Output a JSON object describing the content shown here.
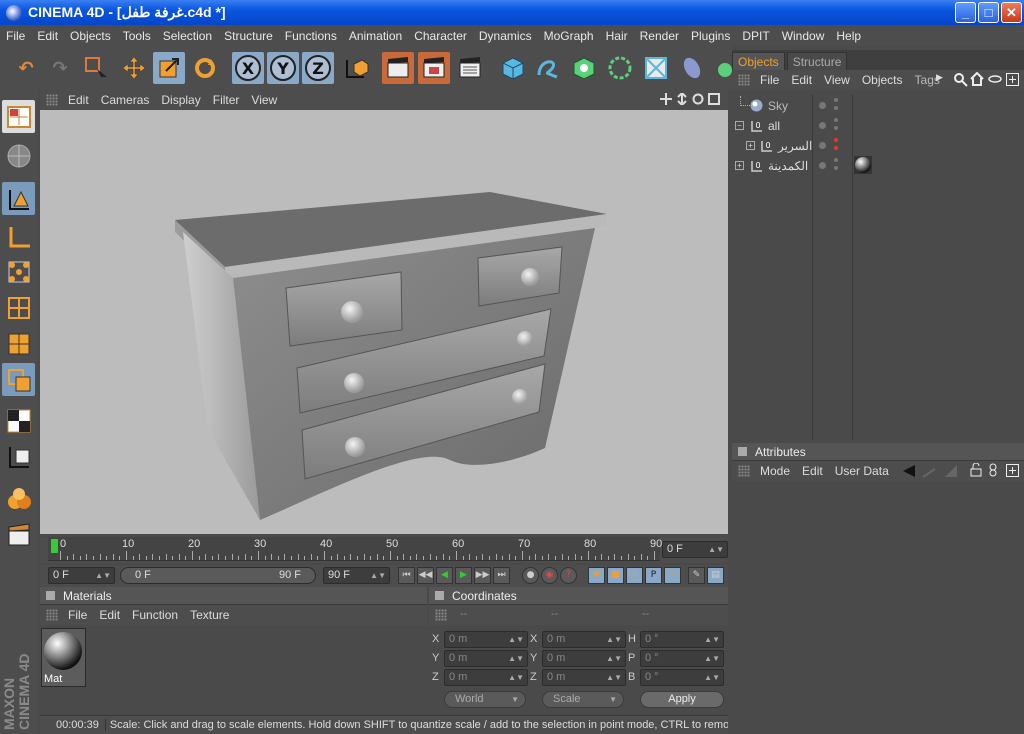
{
  "window": {
    "title": "CINEMA 4D - [غرفة طفل.c4d *]",
    "minimize": "_",
    "maximize": "□",
    "close": "✕"
  },
  "menubar": [
    "File",
    "Edit",
    "Objects",
    "Tools",
    "Selection",
    "Structure",
    "Functions",
    "Animation",
    "Character",
    "Dynamics",
    "MoGraph",
    "Hair",
    "Render",
    "Plugins",
    "DPIT",
    "Window",
    "Help"
  ],
  "toolbar": {
    "axes": [
      "X",
      "Y",
      "Z"
    ],
    "tools": [
      "undo-icon",
      "redo-icon",
      "live-selection-icon",
      "move-icon",
      "scale-icon",
      "rotate-icon",
      "x-axis-icon",
      "y-axis-icon",
      "z-axis-icon",
      "world-coordinates-icon",
      "render-view-icon",
      "render-picture-viewer-icon",
      "render-settings-icon",
      "cube-icon",
      "spline-icon",
      "nurbs-icon",
      "array-icon",
      "deformer-icon",
      "scene-icon",
      "light-icon"
    ]
  },
  "viewport": {
    "menu": [
      "Edit",
      "Cameras",
      "Display",
      "Filter",
      "View"
    ]
  },
  "timeline": {
    "ticks": [
      "0",
      "10",
      "20",
      "30",
      "40",
      "50",
      "60",
      "70",
      "80",
      "90"
    ],
    "current_frame": "0 F",
    "start_frame": "0 F",
    "range_start": "0 F",
    "range_end": "90 F",
    "end_frame": "90 F"
  },
  "materials": {
    "title": "Materials",
    "menu": [
      "File",
      "Edit",
      "Function",
      "Texture"
    ],
    "items": [
      {
        "name": "Mat"
      }
    ]
  },
  "coordinates": {
    "title": "Coordinates",
    "header": [
      "--",
      "--",
      "--"
    ],
    "rows": [
      {
        "l1": "X",
        "v1": "0 m",
        "l2": "X",
        "v2": "0 m",
        "l3": "H",
        "v3": "0 °"
      },
      {
        "l1": "Y",
        "v1": "0 m",
        "l2": "Y",
        "v2": "0 m",
        "l3": "P",
        "v3": "0 °"
      },
      {
        "l1": "Z",
        "v1": "0 m",
        "l2": "Z",
        "v2": "0 m",
        "l3": "B",
        "v3": "0 °"
      }
    ],
    "mode": "World",
    "transform": "Scale",
    "apply": "Apply"
  },
  "status": {
    "time": "00:00:39",
    "message": "Scale: Click and drag to scale elements. Hold down SHIFT to quantize scale / add to the selection in point mode, CTRL to remove."
  },
  "objects_panel": {
    "tabs": [
      "Objects",
      "Structure"
    ],
    "menu": [
      "File",
      "Edit",
      "View",
      "Objects",
      "Tags"
    ],
    "items": [
      {
        "name": "Sky",
        "type": "sky"
      },
      {
        "name": "all",
        "type": "null"
      },
      {
        "name": "السرير",
        "type": "null"
      },
      {
        "name": "الكمدينة",
        "type": "null"
      }
    ]
  },
  "attributes_panel": {
    "title": "Attributes",
    "menu": [
      "Mode",
      "Edit",
      "User Data"
    ]
  },
  "colors": {
    "accent": "#f0a030",
    "selected_tool": "#8aa8c8",
    "viewport_bg": "#bcbcbc"
  }
}
